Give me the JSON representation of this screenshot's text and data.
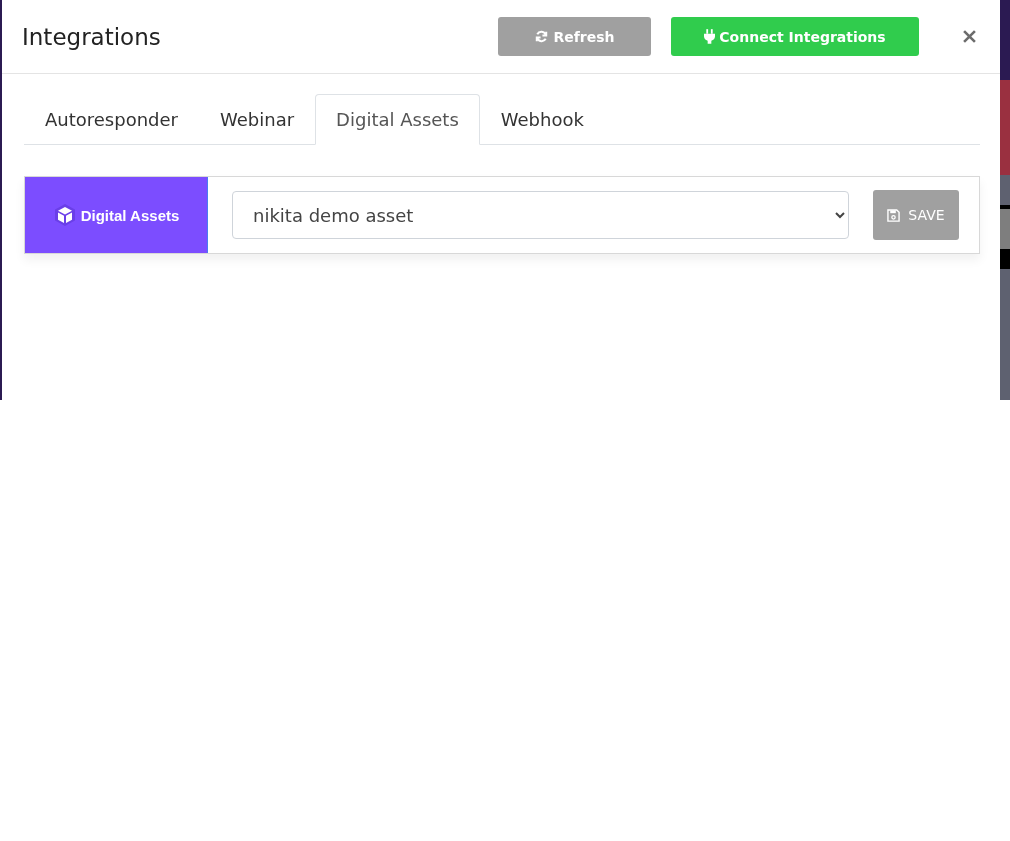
{
  "modal": {
    "title": "Integrations",
    "buttons": [
      {
        "label": "Refresh",
        "kind": "refresh"
      },
      {
        "label": "Connect Integrations",
        "kind": "connect"
      }
    ]
  },
  "tabs": [
    {
      "label": "Autoresponder",
      "selected": false
    },
    {
      "label": "Webinar",
      "selected": false
    },
    {
      "label": "Digital Assets",
      "selected": true
    },
    {
      "label": "Webhook",
      "selected": false
    }
  ],
  "integration": {
    "brand": "Digital Assets",
    "asset": {
      "value": "nikita demo asset"
    },
    "save_button": "SAVE"
  }
}
